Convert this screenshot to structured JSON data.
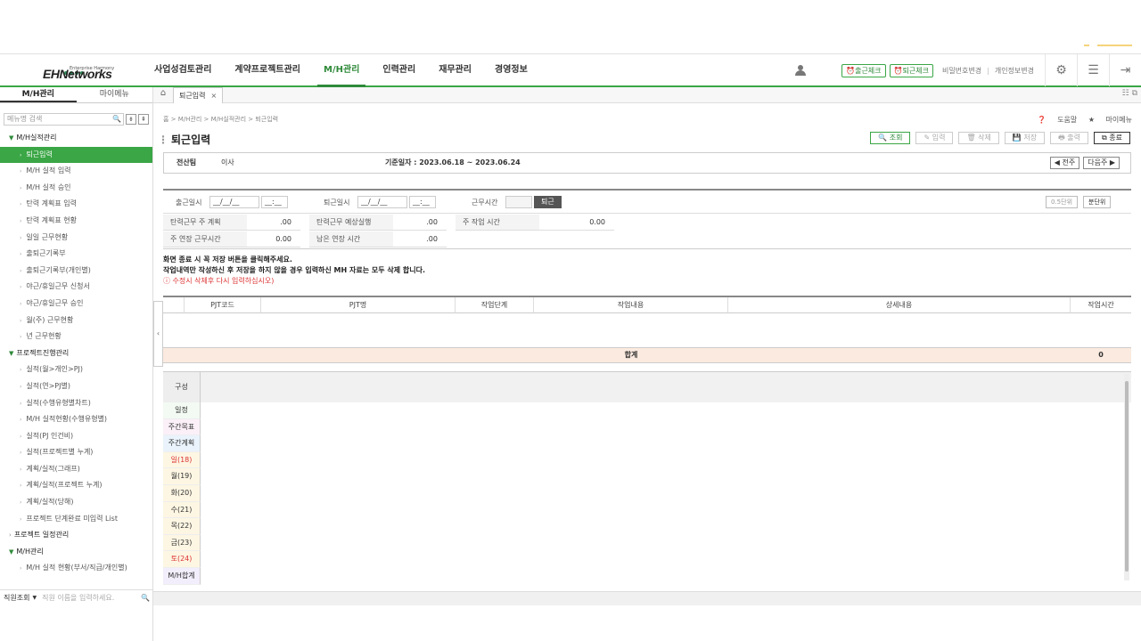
{
  "header": {
    "logo_text": "EHNetworks",
    "logo_sub": "Enterprise Harmony",
    "menus": [
      "사업성검토관리",
      "계약프로젝트관리",
      "M/H관리",
      "인력관리",
      "재무관리",
      "경영정보"
    ],
    "active_menu": "M/H관리",
    "checkin_label": "출근체크",
    "checkout_label": "퇴근체크",
    "pw_change": "비밀번호변경",
    "info_change": "개인정보변경"
  },
  "sidebar": {
    "tabs": [
      "M/H관리",
      "마이메뉴"
    ],
    "search_placeholder": "메뉴명 검색",
    "groups": [
      {
        "label": "M/H실적관리",
        "open": true,
        "items": [
          "퇴근입력",
          "M/H 실적 입력",
          "M/H 실적 승인",
          "탄력 계획표 입력",
          "탄력 계획표 현황",
          "일일 근무현황",
          "출퇴근기록부",
          "출퇴근기록부(개인별)",
          "야근/휴일근무 신청서",
          "야근/휴일근무 승인",
          "월(주) 근무현황",
          "년 근무현황"
        ]
      },
      {
        "label": "프로젝트진행관리",
        "open": true,
        "items": [
          "실적(월>개인>PJ)",
          "실적(연>PJ별)",
          "실적(수행유형별차트)",
          "M/H 실적현황(수행유형별)",
          "실적(PJ 인건비)",
          "실적(프로젝트별 누계)",
          "계획/실적(그래프)",
          "계획/실적(프로젝트 누계)",
          "계획/실적(당해)",
          "프로젝트 단계완료 미입력 List"
        ]
      },
      {
        "label": "프로젝트 일정관리",
        "open": false,
        "items": []
      },
      {
        "label": "M/H관리",
        "open": true,
        "items": [
          "M/H 실적 현황(부서/직급/개인별)"
        ]
      }
    ],
    "active_item": "퇴근입력",
    "footer_select": "직원조회",
    "footer_placeholder": "직원 이름을 입력하세요."
  },
  "tabs": {
    "open_tab": "퇴근입력"
  },
  "page": {
    "breadcrumb": "홈 > M/H관리 > M/H실적관리 > 퇴근입력",
    "title": "퇴근입력",
    "help": "도움말",
    "mymenu": "마이메뉴",
    "actions": [
      "조회",
      "입력",
      "삭제",
      "저장",
      "출력",
      "종료"
    ]
  },
  "info": {
    "dept_label": "전산팀",
    "name": "이사",
    "period": "기준일자 : 2023.06.18 ~ 2023.06.24",
    "prev": "◀ 전주",
    "next": "다음주 ▶"
  },
  "form": {
    "start_label": "출근일시",
    "end_label": "퇴근일시",
    "date_mask": "__/__/__",
    "time_mask": "__:__",
    "worktime_label": "근무시간",
    "leave_button": "퇴근",
    "unit_half": "0.5단위",
    "unit_min": "분단위",
    "flex_plan_label": "탄력근무 주 계획",
    "flex_plan_val": ".00",
    "flex_expect_label": "탄력근무 예상실행",
    "flex_expect_val": ".00",
    "week_work_label": "주 작업 시간",
    "week_work_val": "0.00",
    "ext_label": "주 연장 근무시간",
    "ext_val": "0.00",
    "remain_label": "남은 연장 시간",
    "remain_val": ".00"
  },
  "notice": {
    "line1": "화면 종료 시 꼭 저장 버튼을 클릭해주세요.",
    "line2": "작업내역만 작성하신 후 저장을 하지 않을 경우 입력하신 MH 자료는 모두 삭제 합니다.",
    "line3": "수정시 삭제후 다시 입력하십시오)"
  },
  "table": {
    "columns": [
      "PJT코드",
      "PJT명",
      "작업단계",
      "작업내용",
      "상세내용",
      "작업시간"
    ],
    "sum_label": "합계",
    "sum_value": "0"
  },
  "schedule": {
    "header": "구성",
    "rows": [
      {
        "label": "일정",
        "color": "#333",
        "bg": "#f3faf3"
      },
      {
        "label": "주간목표",
        "color": "#333",
        "bg": "#fbf0f8"
      },
      {
        "label": "주간계획",
        "color": "#333",
        "bg": "#eaf3fb"
      },
      {
        "label": "일(18)",
        "color": "#d33",
        "bg": "#fdf6e3"
      },
      {
        "label": "월(19)",
        "color": "#333",
        "bg": "#fdf6e3"
      },
      {
        "label": "화(20)",
        "color": "#333",
        "bg": "#fdf6e3"
      },
      {
        "label": "수(21)",
        "color": "#333",
        "bg": "#fdf6e3"
      },
      {
        "label": "목(22)",
        "color": "#333",
        "bg": "#fdf6e3"
      },
      {
        "label": "금(23)",
        "color": "#333",
        "bg": "#fdf6e3"
      },
      {
        "label": "토(24)",
        "color": "#d33",
        "bg": "#fdf6e3"
      },
      {
        "label": "M/H합계",
        "color": "#333",
        "bg": "#f3eefb"
      }
    ]
  }
}
